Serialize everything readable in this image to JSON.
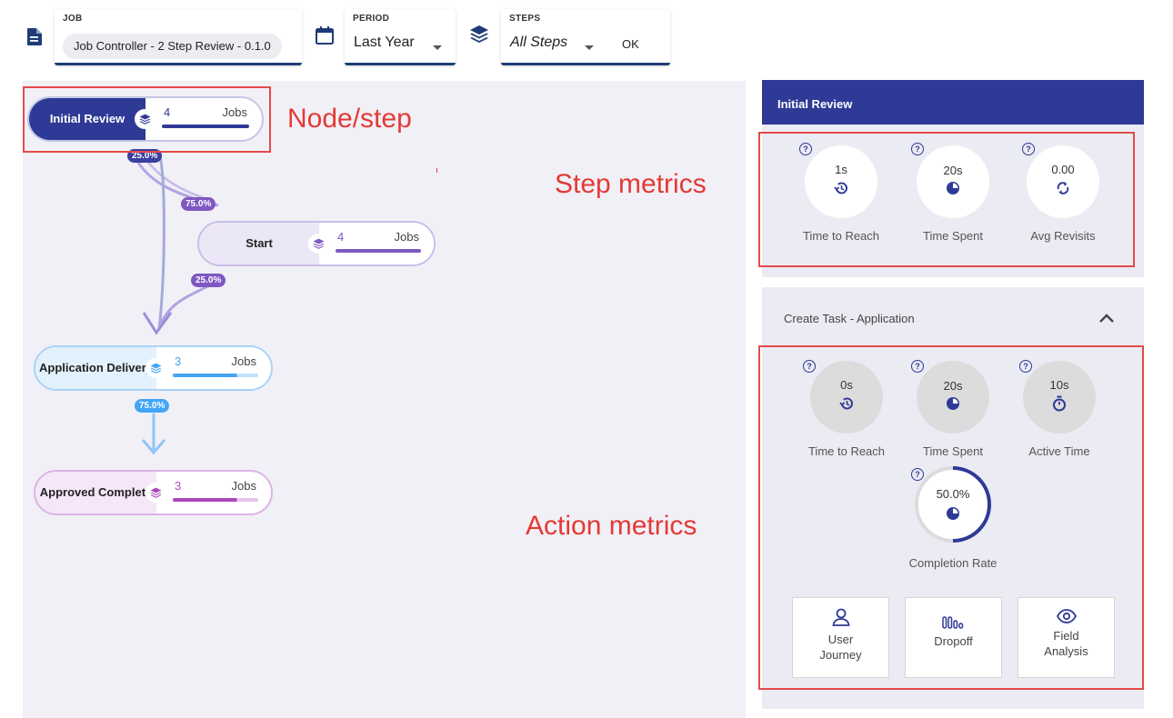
{
  "toolbar": {
    "job_label": "JOB",
    "job_value": "Job Controller - 2 Step Review - 0.1.0",
    "period_label": "PERIOD",
    "period_value": "Last Year",
    "steps_label": "STEPS",
    "steps_value": "All Steps",
    "ok_label": "OK"
  },
  "graph": {
    "nodes": [
      {
        "name": "Initial Review",
        "count": "4",
        "unit": "Jobs"
      },
      {
        "name": "Start",
        "count": "4",
        "unit": "Jobs"
      },
      {
        "name": "Application Delivery",
        "count": "3",
        "unit": "Jobs"
      },
      {
        "name": "Approved Complete",
        "count": "3",
        "unit": "Jobs"
      }
    ],
    "edges": [
      {
        "label": "25.0%"
      },
      {
        "label": "75.0%"
      },
      {
        "label": "25.0%"
      },
      {
        "label": "75.0%"
      }
    ]
  },
  "annotations": {
    "node": "Node/step",
    "step_metrics": "Step metrics",
    "action_metrics": "Action metrics"
  },
  "panel": {
    "title": "Initial Review",
    "step_metrics": [
      {
        "value": "1s",
        "label": "Time to Reach",
        "icon": "history-icon"
      },
      {
        "value": "20s",
        "label": "Time Spent",
        "icon": "pie-icon"
      },
      {
        "value": "0.00",
        "label": "Avg Revisits",
        "icon": "refresh-icon"
      }
    ],
    "action_section": {
      "title": "Create Task - Application",
      "metrics": [
        {
          "value": "0s",
          "label": "Time to Reach",
          "icon": "history-icon"
        },
        {
          "value": "20s",
          "label": "Time Spent",
          "icon": "pie-icon"
        },
        {
          "value": "10s",
          "label": "Active Time",
          "icon": "stopwatch-icon"
        }
      ],
      "completion": {
        "value": "50.0%",
        "label": "Completion Rate",
        "fraction": 0.5
      },
      "buttons": [
        {
          "label_1": "User",
          "label_2": "Journey",
          "icon": "user-icon"
        },
        {
          "label_1": "Dropoff",
          "icon": "bars-icon"
        },
        {
          "label_1": "Field",
          "label_2": "Analysis",
          "icon": "eye-icon"
        }
      ]
    },
    "help_glyph": "?"
  },
  "colors": {
    "navy": "#2e3a96",
    "purple": "#7e57c2",
    "blue": "#42a5f5",
    "magenta": "#ab47bc",
    "annotation_red": "#e53935"
  }
}
